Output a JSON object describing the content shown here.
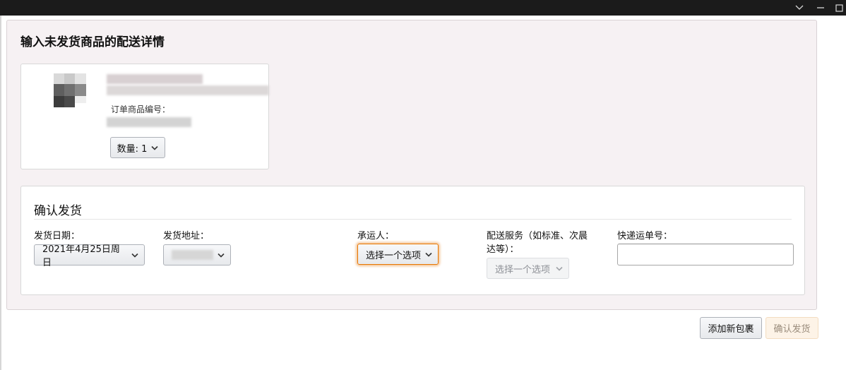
{
  "panel": {
    "title": "输入未发货商品的配送详情"
  },
  "item": {
    "sku_label": "订单商品编号：",
    "quantity_label": "数量: 1"
  },
  "shipment": {
    "title": "确认发货",
    "ship_date": {
      "label": "发货日期：",
      "value": "2021年4月25日周日"
    },
    "ship_address": {
      "label": "发货地址："
    },
    "carrier": {
      "label": "承运人：",
      "value": "选择一个选项"
    },
    "service": {
      "label_line1": "配送服务（如标准、次晨",
      "label_line2": "达等）：",
      "value": "选择一个选项"
    },
    "tracking": {
      "label": "快递运单号：",
      "value": ""
    }
  },
  "actions": {
    "add_package": "添加新包裹",
    "confirm_ship": "确认发货"
  },
  "icons": {
    "window_minimize": "chevron-down-icon",
    "window_restore": "restore-icon",
    "dropdown": "chevron-down-icon"
  },
  "colors": {
    "focus_accent": "#e77600",
    "panel_bg": "#f6f1f3",
    "confirm_disabled_bg": "#fdf3e7"
  }
}
